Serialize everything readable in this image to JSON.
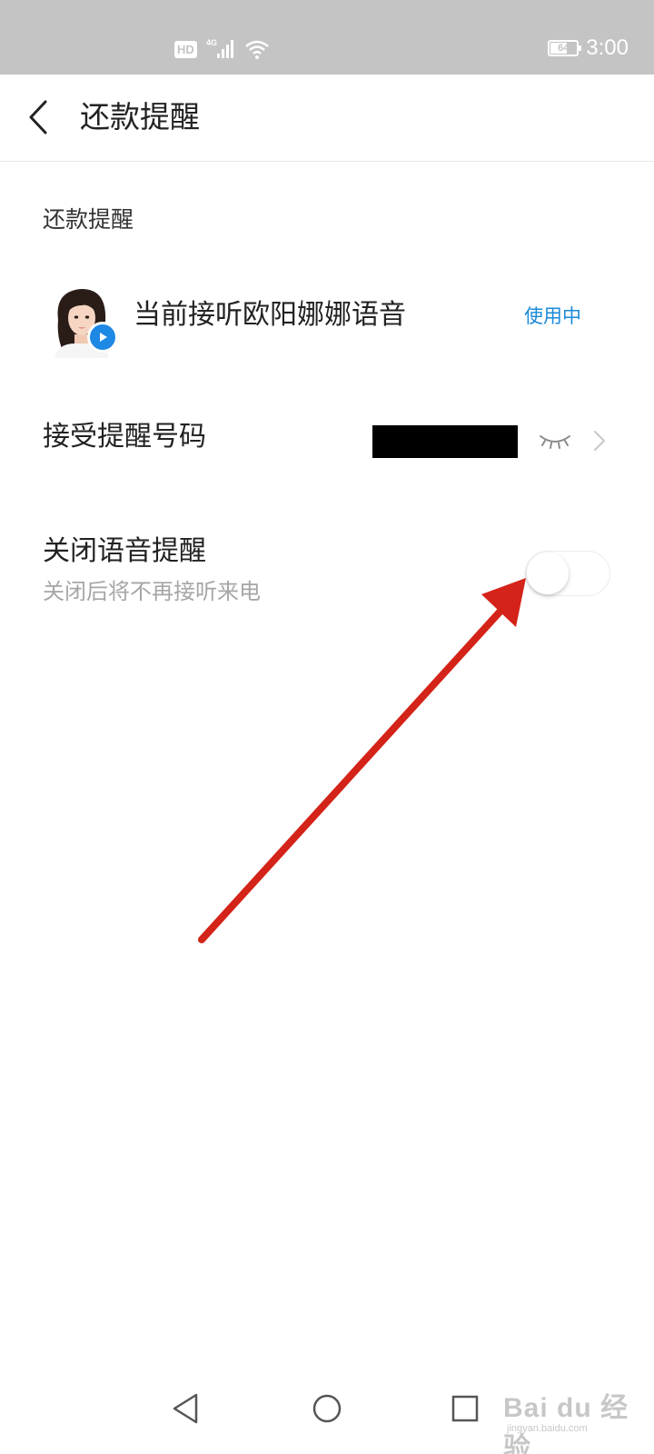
{
  "status_bar": {
    "hd": "HD",
    "network": "4G",
    "battery": "64",
    "battery_level": 0.64,
    "time": "3:00"
  },
  "header": {
    "title": "还款提醒",
    "back_icon": "chevron-left-icon"
  },
  "section": {
    "title": "还款提醒"
  },
  "voice": {
    "label": "当前接听欧阳娜娜语音",
    "status": "使用中",
    "status_color": "#1a8ad9"
  },
  "phone": {
    "label": "接受提醒号码",
    "eye_icon": "eye-closed-icon",
    "chevron_icon": "chevron-right-icon"
  },
  "voice_toggle": {
    "label": "关闭语音提醒",
    "sublabel": "关闭后将不再接听来电",
    "on": false
  },
  "annotation": {
    "color": "#d42318"
  },
  "nav_bar": {
    "back_icon": "triangle-back-icon",
    "home_icon": "circle-home-icon",
    "recents_icon": "square-recents-icon"
  },
  "watermark": {
    "text": "Bai du 经验",
    "url": "jingyan.baidu.com"
  }
}
